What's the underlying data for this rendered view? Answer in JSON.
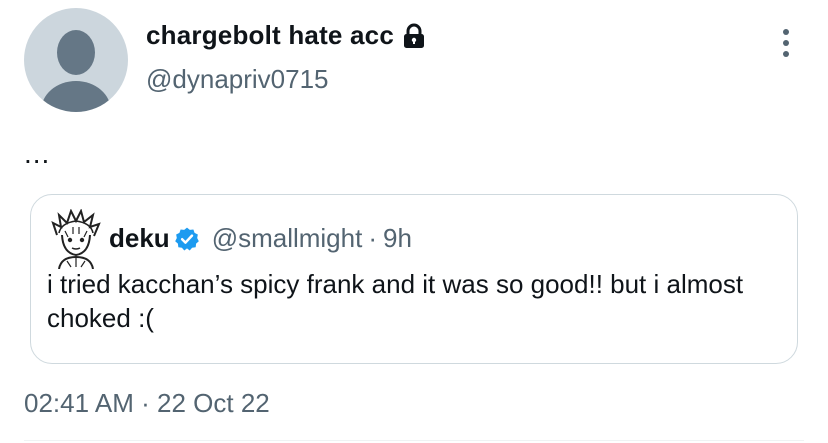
{
  "author": {
    "display_name": "chargebolt hate acc",
    "handle": "@dynapriv0715",
    "protected_icon": "lock-icon",
    "avatar_icon": "default-profile-avatar"
  },
  "tweet": {
    "text": "...",
    "time": "02:41 AM",
    "separator": "·",
    "date": "22 Oct 22"
  },
  "quoted_tweet": {
    "display_name": "deku",
    "verified_icon": "verified-badge-icon",
    "handle": "@smallmight",
    "separator": "·",
    "time": "9h",
    "text": "i tried kacchan’s spicy frank and it was so good!! but i almost choked :("
  },
  "colors": {
    "primary_text": "#0f1419",
    "secondary_text": "#536471",
    "border": "#cfd9de",
    "verified_blue": "#1d9bf0",
    "avatar_bg": "#ccd6dd",
    "avatar_fg": "#657786"
  }
}
